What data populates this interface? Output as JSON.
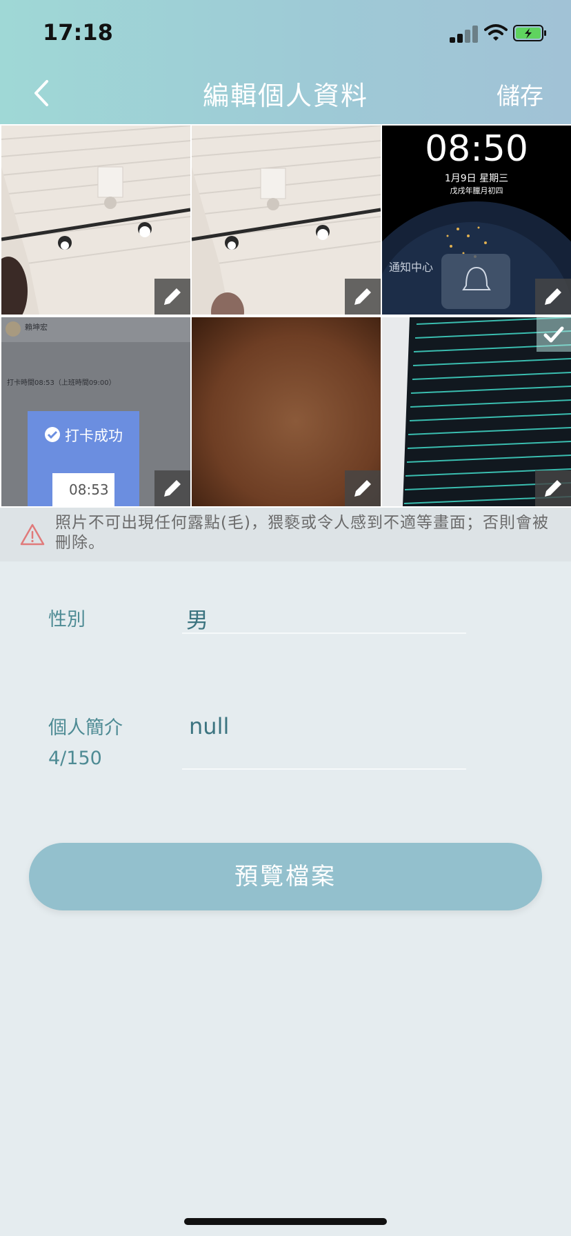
{
  "status_bar": {
    "time": "17:18"
  },
  "nav": {
    "title": "編輯個人資料",
    "save_label": "儲存"
  },
  "photos": [
    {
      "name": "photo-ceiling-lights-1",
      "editable": true
    },
    {
      "name": "photo-ceiling-lights-2",
      "editable": true
    },
    {
      "name": "photo-lock-screen",
      "editable": true,
      "clock": "08:50",
      "date": "1月9日 星期三",
      "lunar": "戊戌年臘月初四",
      "notification_label": "通知中心"
    },
    {
      "name": "photo-checkin-screenshot",
      "editable": true,
      "user": "賴坤宏",
      "line1": "打卡時間08:53（上班時間09:00）",
      "success_label": "打卡成功",
      "time": "08:53"
    },
    {
      "name": "photo-brown-blur",
      "editable": true
    },
    {
      "name": "photo-data-screen",
      "editable": true,
      "selected": true
    }
  ],
  "warning": {
    "text": "照片不可出現任何露點(毛)，猥褻或令人感到不適等畫面；否則會被刪除。"
  },
  "form": {
    "gender_label": "性別",
    "gender_value": "男",
    "bio_label": "個人簡介",
    "bio_count": "4/150",
    "bio_value": "null"
  },
  "preview_button": {
    "label": "預覽檔案"
  },
  "colors": {
    "accent": "#4e8b94",
    "button": "#93c0cd",
    "background": "#e5ecef",
    "warning_icon": "#e07a7a",
    "battery": "#5fd35f"
  }
}
